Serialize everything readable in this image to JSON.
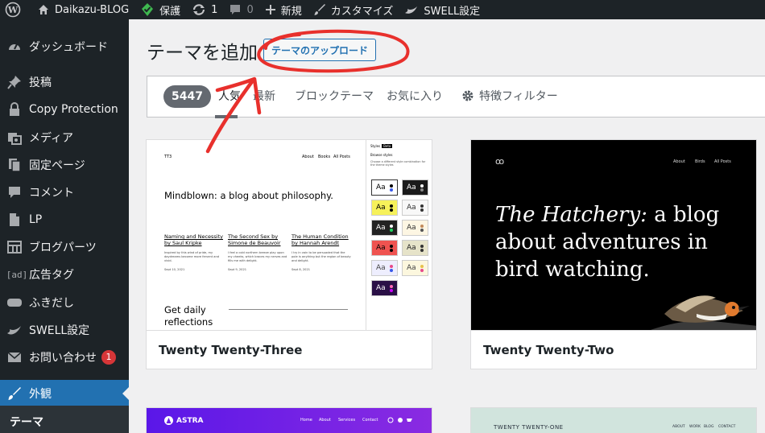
{
  "adminbar": {
    "site_name": "Daikazu-BLOG",
    "protect": "保護",
    "updates_count": "1",
    "comments_count": "0",
    "new": "新規",
    "customize": "カスタマイズ",
    "swell": "SWELL設定"
  },
  "sidebar": {
    "items": [
      {
        "label": "ダッシュボード",
        "icon": "dashboard-icon"
      },
      {
        "label": "投稿",
        "icon": "pin-icon"
      },
      {
        "label": "Copy Protection",
        "icon": "lock-icon"
      },
      {
        "label": "メディア",
        "icon": "media-icon"
      },
      {
        "label": "固定ページ",
        "icon": "page-icon"
      },
      {
        "label": "コメント",
        "icon": "comment-icon"
      },
      {
        "label": "LP",
        "icon": "document-icon"
      },
      {
        "label": "ブログパーツ",
        "icon": "grid-icon"
      },
      {
        "label": "広告タグ",
        "icon": "ad-icon",
        "glyph": "[ad]"
      },
      {
        "label": "ふきだし",
        "icon": "bubble-icon"
      },
      {
        "label": "SWELL設定",
        "icon": "swell-icon"
      },
      {
        "label": "お問い合わせ",
        "icon": "mail-icon",
        "badge": "1"
      },
      {
        "label": "外観",
        "icon": "brush-icon"
      }
    ],
    "submenu_current": "テーマ"
  },
  "page": {
    "title": "テーマを追加",
    "upload_button": "テーマのアップロード"
  },
  "filter": {
    "count": "5447",
    "tabs": [
      "人気",
      "最新",
      "ブロックテーマ",
      "お気に入り"
    ],
    "feature_filter": "特徴フィルター"
  },
  "themes": [
    {
      "name": "Twenty Twenty-Three",
      "preview": {
        "logo": "TT3",
        "nav": [
          "About",
          "Books",
          "All Posts"
        ],
        "headline": "Mindblown: a blog about philosophy.",
        "posts": [
          {
            "title": "Naming and Necessity by Saul Kripke",
            "excerpt": "Inspired by this wind of pride, my daydreams become more fervent and vivid.",
            "date": "Sept 10, 2021"
          },
          {
            "title": "The Second Sex by Simone de Beauvoir",
            "excerpt": "I feel a cold northern breeze play upon my cheeks, which braces my nerves and fills me with delight.",
            "date": "Sept 9, 2021"
          },
          {
            "title": "The Human Condition by Hannah Arendt",
            "excerpt": "I try in vain to be persuaded that the pole is anything but the region of beauty and delight.",
            "date": "Sept 8, 2021"
          }
        ],
        "footer_text": "Get daily reflections",
        "panel": {
          "title": "Styles",
          "tag": "Beta",
          "subtitle": "Browse styles",
          "desc": "Choose a different style combination for the theme styles",
          "swatch_label": "Aa"
        }
      }
    },
    {
      "name": "Twenty Twenty-Two",
      "preview": {
        "logo": "ꝏ",
        "nav": [
          "About",
          "Birds",
          "All Posts"
        ],
        "headline_italic": "The Hatchery:",
        "headline_rest": " a blog about adventures in bird watching."
      }
    },
    {
      "name": "Astra",
      "preview": {
        "brand": "ASTRA",
        "nav": [
          "Home",
          "About",
          "Services",
          "Contact"
        ]
      }
    },
    {
      "name": "Twenty Twenty-One",
      "preview": {
        "brand": "TWENTY TWENTY-ONE",
        "nav": [
          "ABOUT",
          "WORK",
          "BLOG",
          "CONTACT"
        ]
      }
    }
  ],
  "colors": {
    "adminbar_bg": "#1d2327",
    "accent": "#2271b1",
    "annotation": "#e8302c"
  }
}
